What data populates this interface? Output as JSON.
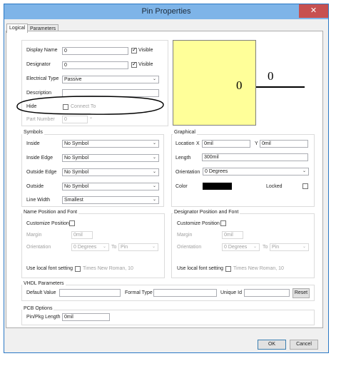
{
  "window": {
    "title": "Pin Properties",
    "close_glyph": "✕"
  },
  "tabs": [
    {
      "label": "Logical"
    },
    {
      "label": "Parameters"
    }
  ],
  "logical": {
    "display_name": {
      "label": "Display Name",
      "value": "0",
      "visible_label": "Visible",
      "visible_checked": true
    },
    "designator": {
      "label": "Designator",
      "value": "0",
      "visible_label": "Visible",
      "visible_checked": true
    },
    "electrical_type": {
      "label": "Electrical Type",
      "value": "Passive"
    },
    "description": {
      "label": "Description",
      "value": ""
    },
    "hide": {
      "label": "Hide",
      "connect_to_label": "Connect To",
      "checked": false
    },
    "part_number": {
      "label": "Part Number",
      "value": "0"
    }
  },
  "preview": {
    "body_color": "#ffff99",
    "name_text": "0",
    "designator_text": "0"
  },
  "symbols": {
    "title": "Symbols",
    "rows": [
      {
        "label": "Inside",
        "value": "No Symbol"
      },
      {
        "label": "Inside Edge",
        "value": "No Symbol"
      },
      {
        "label": "Outside Edge",
        "value": "No Symbol"
      },
      {
        "label": "Outside",
        "value": "No Symbol"
      },
      {
        "label": "Line Width",
        "value": "Smallest"
      }
    ]
  },
  "graphical": {
    "title": "Graphical",
    "location_label": "Location",
    "x_label": "X",
    "x_value": "0mil",
    "y_label": "Y",
    "y_value": "0mil",
    "length_label": "Length",
    "length_value": "300mil",
    "orientation_label": "Orientation",
    "orientation_value": "0 Degrees",
    "color_label": "Color",
    "color_value": "#000000",
    "locked_label": "Locked",
    "locked_checked": false
  },
  "name_font": {
    "title": "Name Position and Font",
    "customize_label": "Customize Position",
    "margin_label": "Margin",
    "margin_value": "0mil",
    "orientation_label": "Orientation",
    "orientation_value": "0 Degrees",
    "to_label": "To",
    "to_value": "Pin",
    "local_font_label": "Use local font setting",
    "font_value": "Times New Roman, 10"
  },
  "designator_font": {
    "title": "Designator Position and Font",
    "customize_label": "Customize Position",
    "margin_label": "Margin",
    "margin_value": "0mil",
    "orientation_label": "Orientation",
    "orientation_value": "0 Degrees",
    "to_label": "To",
    "to_value": "Pin",
    "local_font_label": "Use local font setting",
    "font_value": "Times New Roman, 10"
  },
  "vhdl": {
    "title": "VHDL Parameters",
    "default_value_label": "Default Value",
    "default_value": "",
    "formal_type_label": "Formal Type",
    "formal_type": "",
    "unique_id_label": "Unique Id",
    "unique_id": "",
    "reset_label": "Reset"
  },
  "pcb": {
    "title": "PCB Options",
    "pin_length_label": "Pin/Pkg Length",
    "pin_length_value": "0mil"
  },
  "buttons": {
    "ok": "OK",
    "cancel": "Cancel"
  },
  "annotation_color": "#000000",
  "dropdown_arrow": "⌄"
}
